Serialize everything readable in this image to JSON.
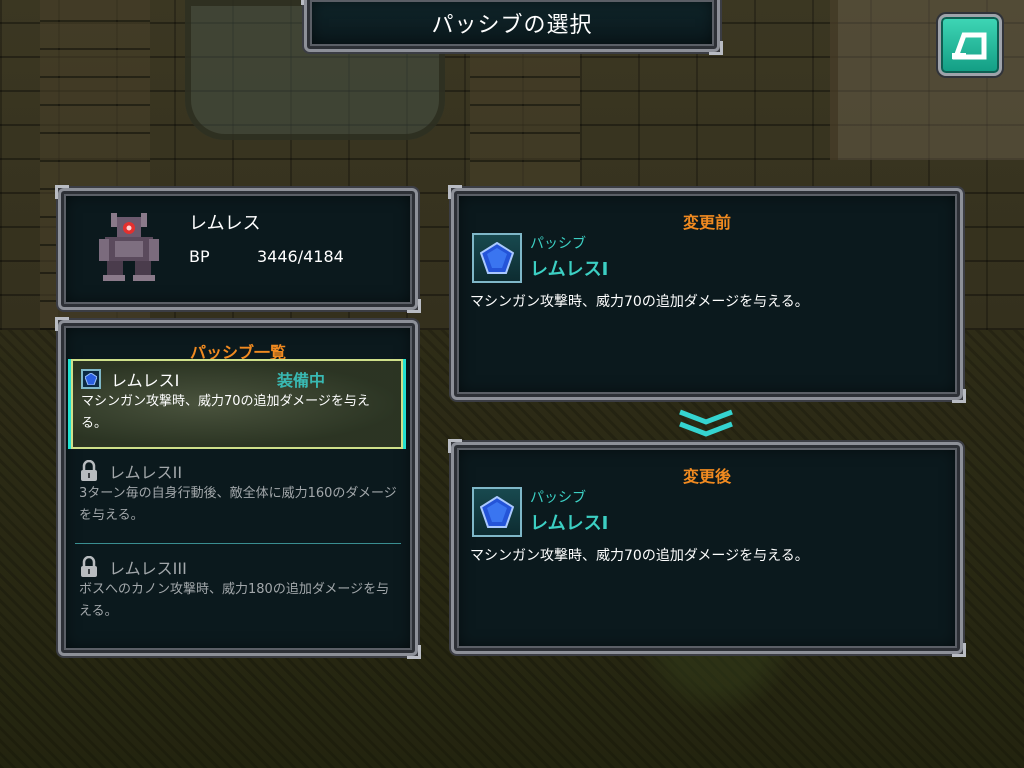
{
  "header": {
    "title": "パッシブの選択"
  },
  "back_button": {
    "icon": "back-arrow-icon",
    "color": "#2bc4a4"
  },
  "character": {
    "name": "レムレス",
    "bp_label": "BP",
    "bp_value": "3446/4184"
  },
  "passive_list": {
    "title": "パッシブ一覧",
    "items": [
      {
        "name": "レムレスI",
        "status": "装備中",
        "description": "マシンガン攻撃時、威力70の追加ダメージを与える。",
        "locked": false,
        "selected": true
      },
      {
        "name": "レムレスII",
        "description": "3ターン毎の自身行動後、敵全体に威力160のダメージを与える。",
        "locked": true
      },
      {
        "name": "レムレスIII",
        "description": "ボスへのカノン攻撃時、威力180の追加ダメージを与える。",
        "locked": true
      }
    ]
  },
  "before": {
    "title": "変更前",
    "category": "パッシブ",
    "name": "レムレスI",
    "description": "マシンガン攻撃時、威力70の追加ダメージを与える。"
  },
  "after": {
    "title": "変更後",
    "category": "パッシブ",
    "name": "レムレスI",
    "description": "マシンガン攻撃時、威力70の追加ダメージを与える。"
  },
  "colors": {
    "accent_orange": "#f08a20",
    "accent_cyan": "#3ccfc3",
    "panel_bg": "#0b191d"
  }
}
